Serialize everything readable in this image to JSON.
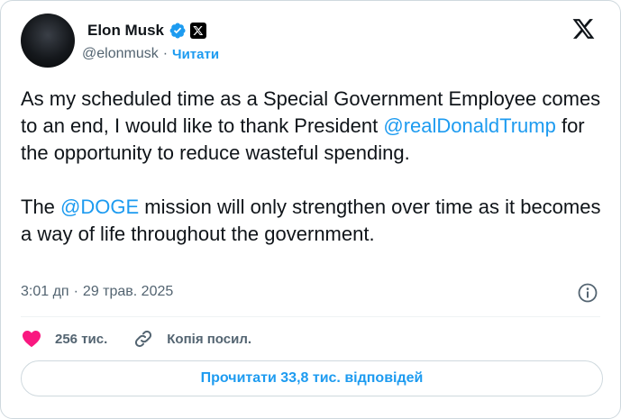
{
  "author": {
    "display_name": "Elon Musk",
    "handle": "@elonmusk",
    "separator": "·",
    "follow_label": "Читати"
  },
  "tweet": {
    "paragraph1_prefix": "As my scheduled time as a Special Government Employee comes to an end, I would like to thank President ",
    "mention1": "@realDonaldTrump",
    "paragraph1_suffix": " for the opportunity to reduce wasteful spending.",
    "paragraph2_prefix": "The ",
    "mention2": "@DOGE",
    "paragraph2_suffix": " mission will only strengthen over time as it becomes a way of life throughout the government."
  },
  "meta": {
    "time": "3:01 дп",
    "separator": "·",
    "date": "29 трав. 2025"
  },
  "actions": {
    "likes_label": "256 тис.",
    "copy_link_label": "Копія посил."
  },
  "replies_button_label": "Прочитати 33,8 тис. відповідей",
  "colors": {
    "accent": "#1d9bf0",
    "like": "#f91880",
    "muted": "#536471",
    "text": "#0f1419"
  },
  "icons": [
    "verified-badge-icon",
    "x-affiliate-icon",
    "x-logo-icon",
    "info-icon",
    "heart-icon",
    "link-icon"
  ]
}
